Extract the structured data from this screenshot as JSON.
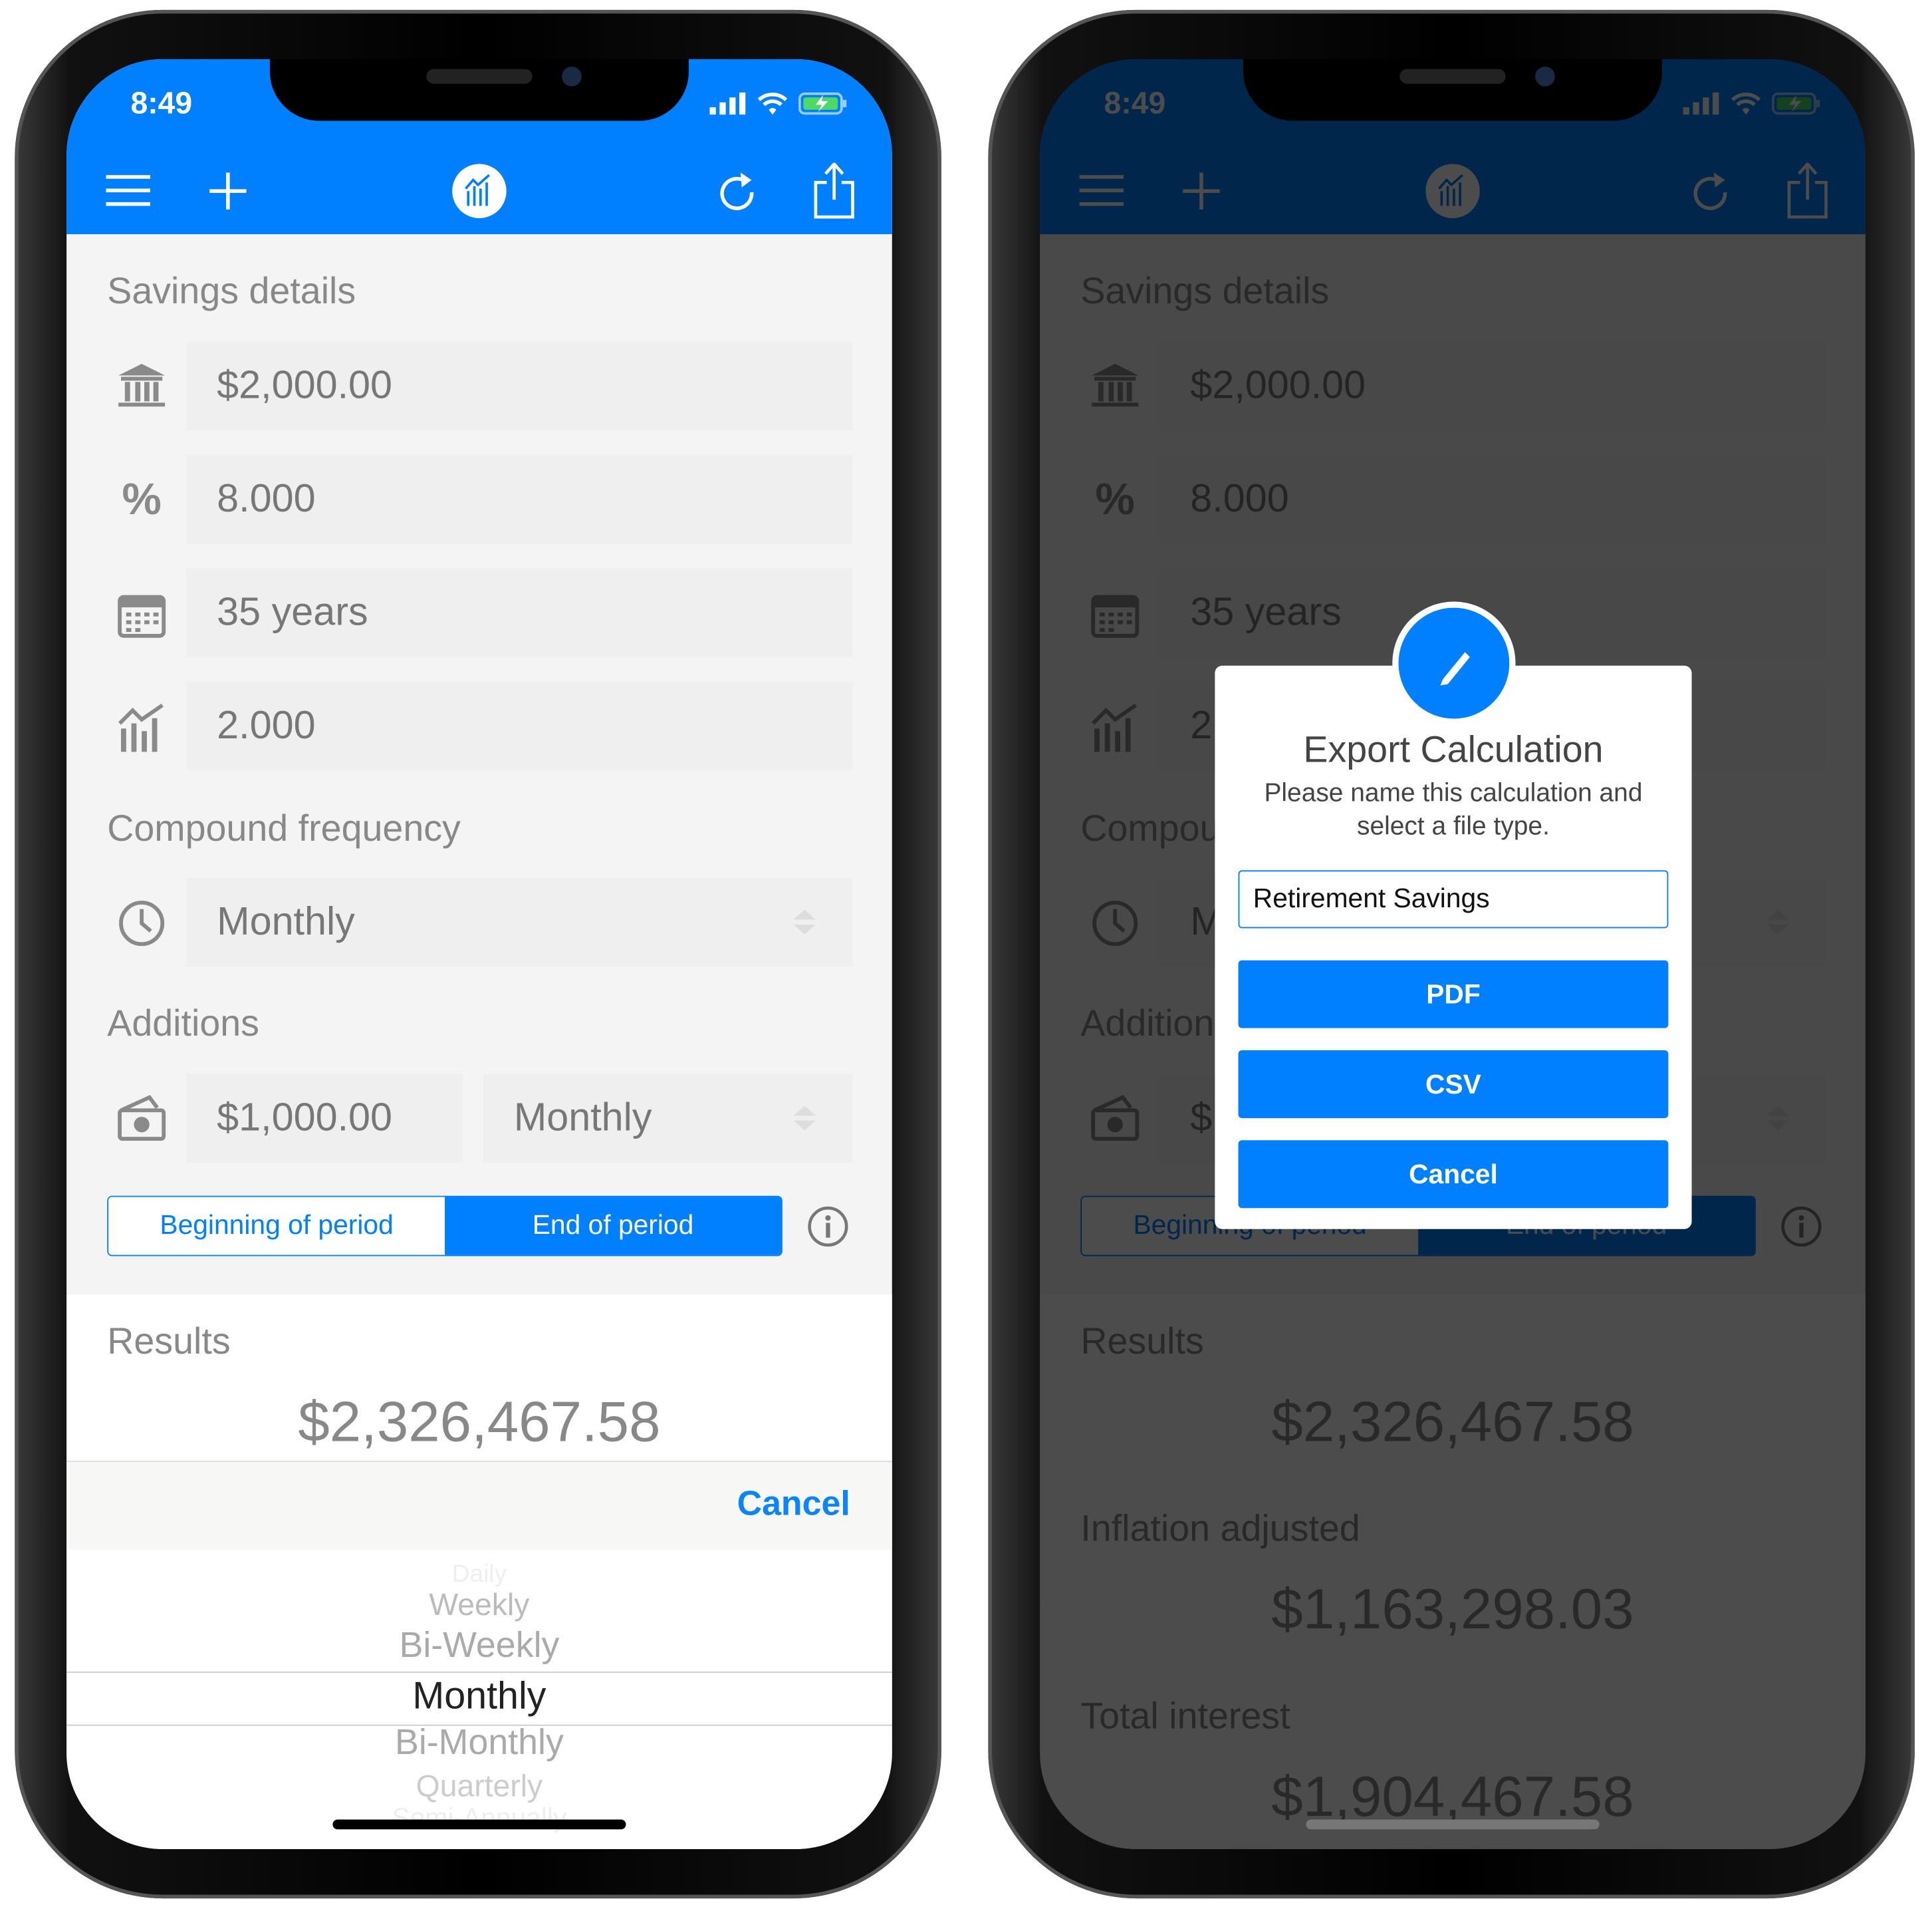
{
  "status": {
    "time": "8:49"
  },
  "colors": {
    "accent": "#0080ff",
    "background": "#f4f4f4"
  },
  "nav": {
    "icons": [
      "menu-icon",
      "plus-icon",
      "chart-logo-icon",
      "refresh-icon",
      "share-icon"
    ]
  },
  "form": {
    "savings_label": "Savings details",
    "principal": "$2,000.00",
    "rate": "8.000",
    "rate_symbol": "%",
    "term": "35 years",
    "inflation": "2.000",
    "compound_label": "Compound frequency",
    "compound": "Monthly",
    "additions_label": "Additions",
    "addition_amount": "$1,000.00",
    "addition_frequency": "Monthly",
    "segment": {
      "beginning": "Beginning of period",
      "end": "End of period",
      "selected": "End of period"
    }
  },
  "results": {
    "label": "Results",
    "total": "$2,326,467.58",
    "inflation_label": "Inflation adjusted",
    "inflation_value": "$1,163,298.03",
    "interest_label": "Total interest",
    "interest_value": "$1,904,467.58"
  },
  "picker": {
    "cancel": "Cancel",
    "options": [
      "Daily",
      "Weekly",
      "Bi-Weekly",
      "Monthly",
      "Bi-Monthly",
      "Quarterly",
      "Semi-Annually"
    ],
    "selected": "Monthly"
  },
  "dialog": {
    "title": "Export Calculation",
    "message_line1": "Please name this calculation and",
    "message_line2": "select a file type.",
    "name_value": "Retirement Savings",
    "pdf": "PDF",
    "csv": "CSV",
    "cancel": "Cancel"
  }
}
